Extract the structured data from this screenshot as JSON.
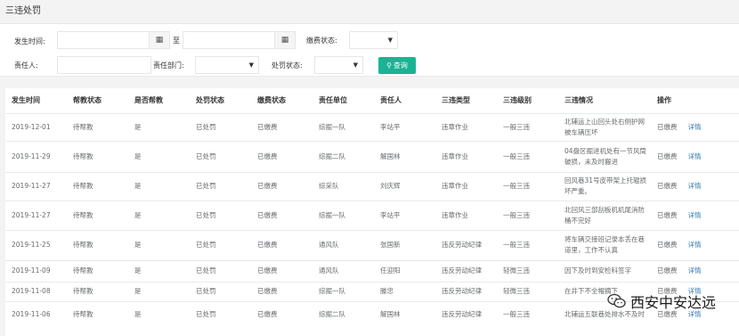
{
  "page": {
    "title": "三违处罚"
  },
  "filters": {
    "occur_time_label": "发生时间:",
    "to_label": "至",
    "fee_status_label": "缴费状态:",
    "responsible_label": "责任人:",
    "dept_label": "责任部门:",
    "penalty_status_label": "处罚状态:",
    "search_label": "查询"
  },
  "table": {
    "headers": [
      "发生时间",
      "帮教状态",
      "是否帮教",
      "处罚状态",
      "缴费状态",
      "责任单位",
      "责任人",
      "三违类型",
      "三违级别",
      "三违情况",
      "操作"
    ],
    "rows": [
      [
        "2019-12-01",
        "待帮教",
        "是",
        "已处罚",
        "已缴费",
        "综掘一队",
        "李站平",
        "违章作业",
        "一般三违",
        "北辅运上山回头处右侧护网被车辆压坏",
        "已缴费",
        "详情"
      ],
      [
        "2019-11-29",
        "待帮教",
        "是",
        "已处罚",
        "已缴费",
        "综掘二队",
        "解国林",
        "违章作业",
        "一般三违",
        "04盘区掘进机处有一节风筒破损，未及时搬进",
        "已缴费",
        "详情"
      ],
      [
        "2019-11-27",
        "待帮教",
        "是",
        "已处罚",
        "已缴费",
        "综采队",
        "刘庆辉",
        "违章作业",
        "一般三违",
        "回风巷31号皮带架上托辊损坏严重。",
        "已缴费",
        "详情"
      ],
      [
        "2019-11-27",
        "待帮教",
        "是",
        "已处罚",
        "已缴费",
        "综掘一队",
        "李站平",
        "违章作业",
        "一般三违",
        "北回风三部刮板机机尾消防桶不完好",
        "已缴费",
        "详情"
      ],
      [
        "2019-11-25",
        "待帮教",
        "是",
        "已处罚",
        "已缴费",
        "通风队",
        "张国新",
        "违反劳动纪律",
        "一般三违",
        "将车辆交接班记录本丢在巷道里，工作不认真",
        "已缴费",
        "详情"
      ],
      [
        "2019-11-09",
        "待帮教",
        "是",
        "已处罚",
        "已缴费",
        "通风队",
        "任迎阳",
        "违反劳动纪律",
        "轻微三违",
        "因下及时到安检科签字",
        "已缴费",
        "详情"
      ],
      [
        "2019-11-08",
        "待帮教",
        "是",
        "已处罚",
        "已缴费",
        "综掘一队",
        "滕忠",
        "违反劳动纪律",
        "轻微三违",
        "在井下不全帽摘下",
        "已缴费",
        "详情"
      ],
      [
        "2019-11-06",
        "待帮教",
        "是",
        "已处罚",
        "已缴费",
        "综掘二队",
        "解国林",
        "违反劳动纪律",
        "一般三违",
        "北辅运五联巷处排水不及时",
        "已缴费",
        "详情"
      ]
    ]
  },
  "watermark": {
    "text": "西安中安达远"
  }
}
